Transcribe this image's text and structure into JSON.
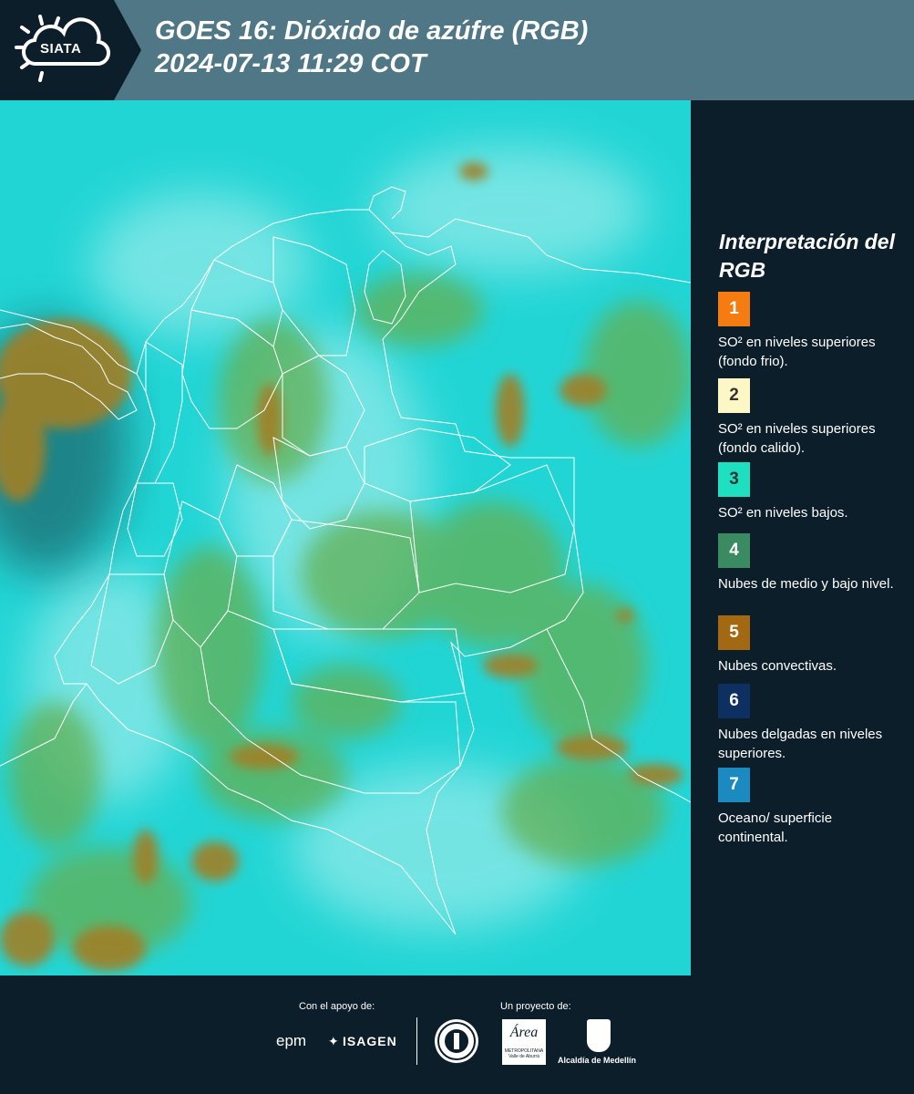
{
  "header": {
    "logo_text": "SIATA",
    "title_line1": "GOES 16: Dióxido de azúfre (RGB)",
    "title_line2": " 2024-07-13 11:29 COT"
  },
  "legend": {
    "title": "Interpretación del RGB",
    "items": [
      {
        "number": "1",
        "color": "#f47c10",
        "label": "SO² en niveles superiores (fondo frio)."
      },
      {
        "number": "2",
        "color": "#fdf6c5",
        "label": "SO² en niveles superiores (fondo calido)."
      },
      {
        "number": "3",
        "color": "#1ee0c0",
        "label": "SO² en niveles bajos."
      },
      {
        "number": "4",
        "color": "#3a8a62",
        "label": "Nubes de medio y bajo nivel."
      },
      {
        "number": "5",
        "color": "#a26812",
        "label": "Nubes convectivas."
      },
      {
        "number": "6",
        "color": "#0d2f62",
        "label": "Nubes delgadas en niveles superiores."
      },
      {
        "number": "7",
        "color": "#1a8ac0",
        "label": "Oceano/ superficie continental."
      }
    ]
  },
  "map": {
    "background_color": "#22d5d5",
    "cloud_color": "#6fb84e",
    "convective_color": "#a08028",
    "boundary_color": "#ffffff"
  },
  "footer": {
    "support_label": "Con el apoyo de:",
    "project_label": "Un proyecto de:",
    "logos": [
      "epm",
      "ISAGEN",
      "Municipio de Medellín",
      "Área Metropolitana",
      "Alcaldía de Medellín"
    ],
    "epm": "epm",
    "isagen": "ISAGEN",
    "area_line1": "Área",
    "area_line2": "METROPOLITANA",
    "area_line3": "Valle de Aburrá",
    "alcaldia": "Alcaldía de Medellín"
  }
}
